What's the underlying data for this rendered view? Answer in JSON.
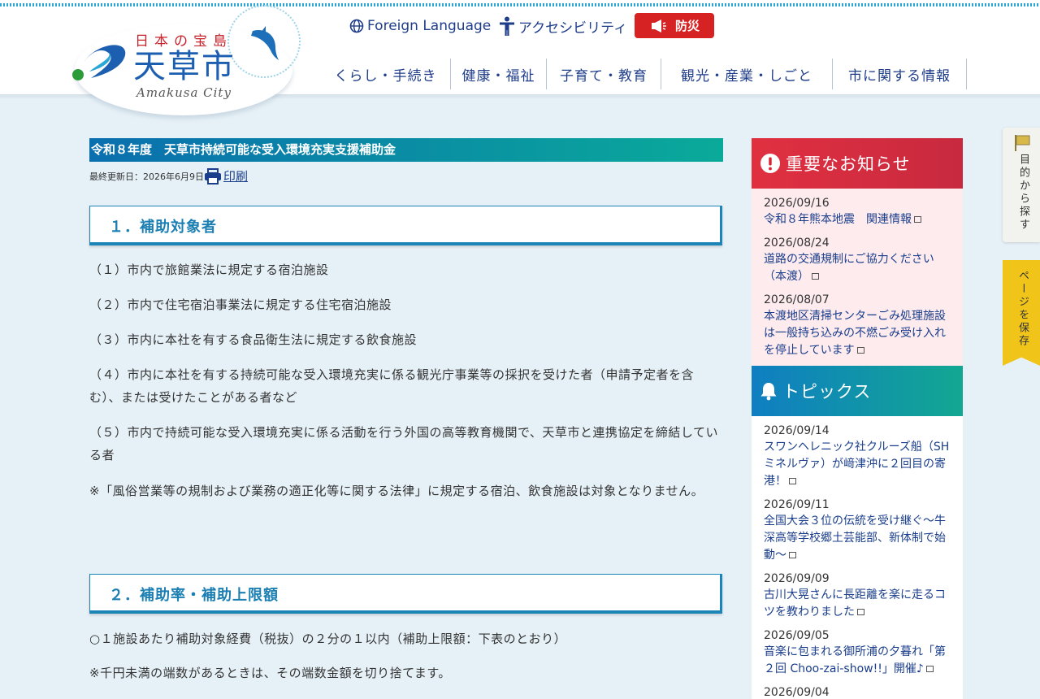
{
  "logo": {
    "tagline": "日本の宝島",
    "city_name": "天草市",
    "city_name_en": "Amakusa City"
  },
  "utility": {
    "foreign_language": "Foreign Language",
    "accessibility": "アクセシビリティ",
    "disaster": "防災"
  },
  "global_nav": [
    {
      "label": "くらし・手続き"
    },
    {
      "label": "健康・福祉"
    },
    {
      "label": "子育て・教育"
    },
    {
      "label": "観光・産業・しごと"
    },
    {
      "label": "市に関する情報"
    }
  ],
  "article": {
    "title": "令和８年度　天草市持続可能な受入環境充実支援補助金",
    "updated": "最終更新日：2026年6月9日",
    "print_label": "印刷",
    "section1": {
      "heading": "１．補助対象者",
      "items": [
        "（１）市内で旅館業法に規定する宿泊施設",
        "（２）市内で住宅宿泊事業法に規定する住宅宿泊施設",
        "（３）市内に本社を有する食品衛生法に規定する飲食施設",
        "（４）市内に本社を有する持続可能な受入環境充実に係る観光庁事業等の採択を受けた者（申請予定者を含む）、または受けたことがある者など",
        "（５）市内で持続可能な受入環境充実に係る活動を行う外国の高等教育機関で、天草市と連携協定を締結している者"
      ],
      "note": "※「風俗営業等の規制および業務の適正化等に関する法律」に規定する宿泊、飲食施設は対象となりません。"
    },
    "section2": {
      "heading": "２．補助率・補助上限額",
      "line1": "○１施設あたり補助対象経費（税抜）の２分の１以内（補助上限額：下表のとおり）",
      "line2": "※千円未満の端数があるときは、その端数金額を切り捨てます。"
    }
  },
  "important": {
    "heading": "重要なお知らせ",
    "items": [
      {
        "date": "2026/09/16",
        "title": "令和８年熊本地震　関連情報"
      },
      {
        "date": "2026/08/24",
        "title": "道路の交通規制にご協力ください（本渡）"
      },
      {
        "date": "2026/08/07",
        "title": "本渡地区清掃センターごみ処理施設は一般持ち込みの不燃ごみ受け入れを停止しています"
      }
    ]
  },
  "topics": {
    "heading": "トピックス",
    "items": [
      {
        "date": "2026/09/14",
        "title": "スワンヘレニック社クルーズ船（SHミネルヴァ）が﨑津沖に２回目の寄港！"
      },
      {
        "date": "2026/09/11",
        "title": "全国大会３位の伝統を受け継ぐ〜牛深高等学校郷土芸能部、新体制で始動〜"
      },
      {
        "date": "2026/09/09",
        "title": "古川大晃さんに長距離を楽に走るコツを教わりました"
      },
      {
        "date": "2026/09/05",
        "title": "音楽に包まれる御所浦の夕暮れ「第２回 Choo-zai-show!!」開催♪"
      },
      {
        "date": "2026/09/04",
        "title": ""
      }
    ]
  },
  "side_tabs": {
    "search": "目的から探す",
    "save": "ページを保存"
  },
  "colors": {
    "accent_blue": "#1b85b8",
    "important_red": "#d62222",
    "save_tab_yellow": "#f0c419"
  }
}
